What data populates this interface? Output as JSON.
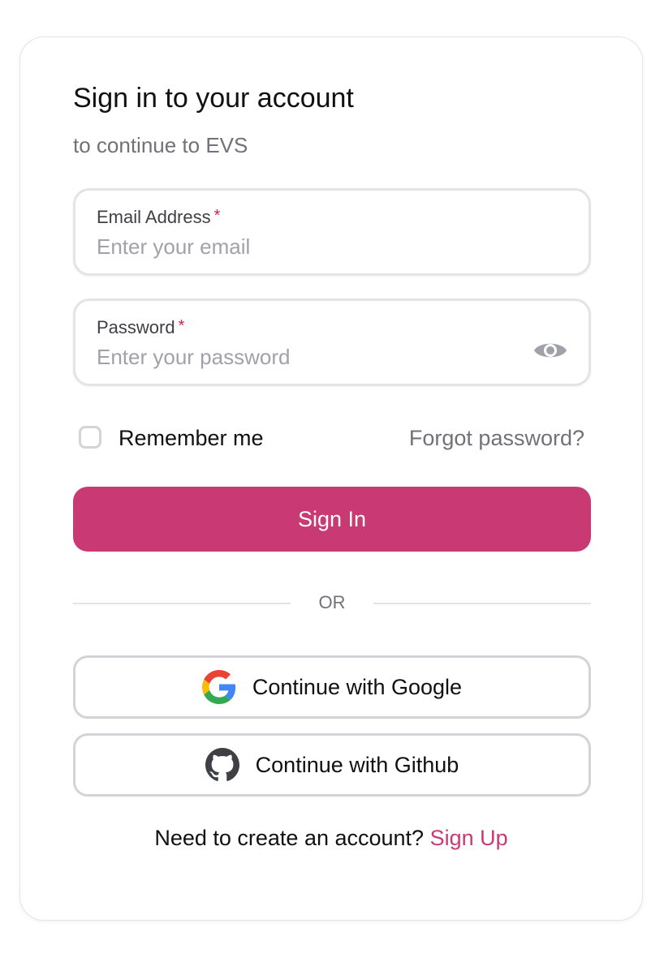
{
  "header": {
    "title": "Sign in to your account",
    "subtitle": "to continue to EVS"
  },
  "form": {
    "email": {
      "label": "Email Address",
      "required_mark": "*",
      "placeholder": "Enter your email",
      "value": ""
    },
    "password": {
      "label": "Password",
      "required_mark": "*",
      "placeholder": "Enter your password",
      "value": ""
    },
    "remember_me": {
      "label": "Remember me",
      "checked": false
    },
    "forgot_password": "Forgot password?",
    "submit_label": "Sign In"
  },
  "divider_label": "OR",
  "oauth": {
    "google_label": "Continue with Google",
    "github_label": "Continue with Github"
  },
  "footer": {
    "prompt": "Need to create an account?",
    "signup_link": "Sign Up"
  },
  "colors": {
    "accent": "#c93a74",
    "required": "#e11d48",
    "muted_text": "#71717a",
    "border": "#e4e4e7"
  },
  "icons": [
    "eye-icon",
    "google-icon",
    "github-icon"
  ]
}
